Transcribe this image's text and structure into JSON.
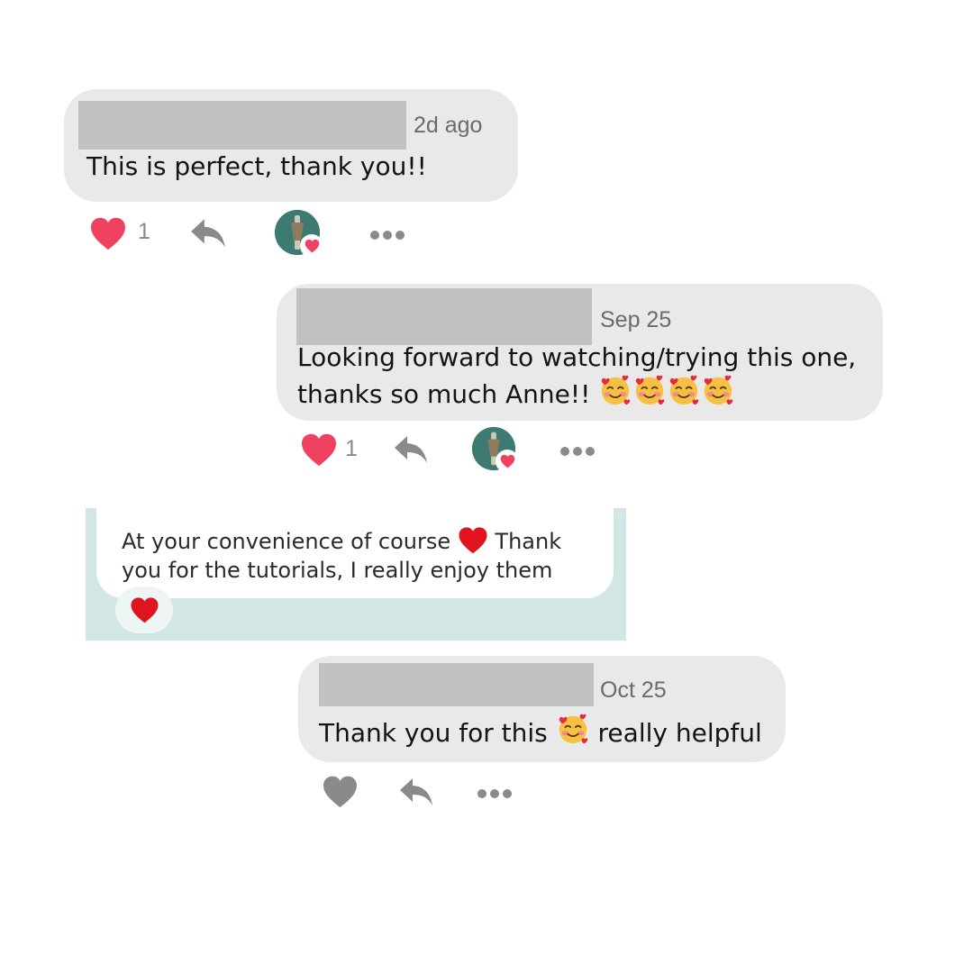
{
  "comments": [
    {
      "time": "2d ago",
      "lines": [
        "This is perfect, thank you!!"
      ],
      "like_count": "1",
      "liked": true,
      "has_creator_heart": true
    },
    {
      "time": "Sep 25",
      "lines": [
        "Looking forward to watching/trying this one,",
        "thanks so much Anne!!"
      ],
      "emoji_count": 4,
      "like_count": "1",
      "liked": true,
      "has_creator_heart": true
    },
    {
      "time": "Oct 25",
      "text_before": "Thank you for this",
      "text_after": "really helpful",
      "liked": false,
      "has_creator_heart": false
    }
  ],
  "direct_message": {
    "line1_before": "At your convenience of course",
    "line1_after": "Thank",
    "line2": "you for the tutorials, I really enjoy them",
    "reaction": "heart"
  },
  "colors": {
    "bubble": "#e9e9e9",
    "redaction": "#c2c2c2",
    "like_red": "#ef4260",
    "icon_grey": "#8a8a8a",
    "dm_panel": "#d3e6e6"
  }
}
